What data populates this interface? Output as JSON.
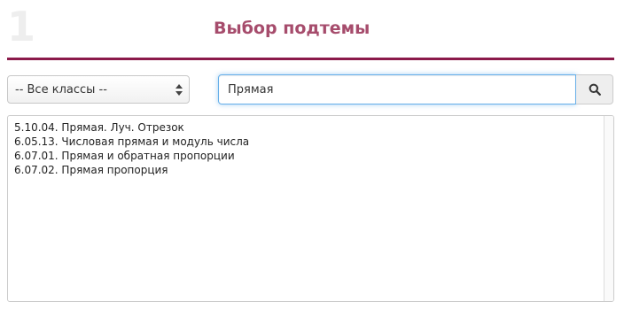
{
  "header": {
    "step_number": "1",
    "title": "Выбор подтемы",
    "accent_color": "#8b1a4a",
    "title_color": "#a64c6c"
  },
  "filters": {
    "class_select": {
      "selected": "-- Все классы --"
    },
    "search": {
      "value": "Прямая",
      "button_icon": "search-icon"
    }
  },
  "results": [
    "5.10.04. Прямая. Луч. Отрезок",
    "6.05.13. Числовая прямая и модуль числа",
    "6.07.01. Прямая и обратная пропорции",
    "6.07.02. Прямая пропорция"
  ]
}
